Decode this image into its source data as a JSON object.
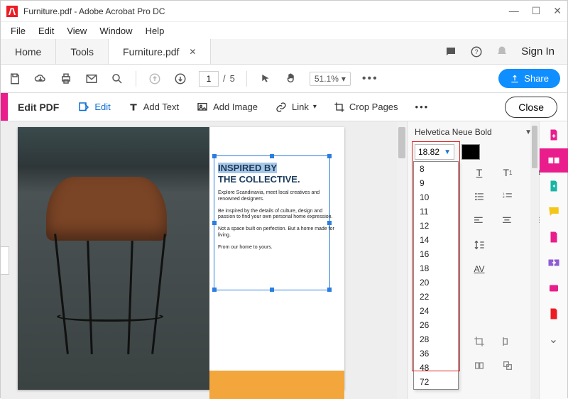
{
  "titlebar": {
    "title": "Furniture.pdf - Adobe Acrobat Pro DC"
  },
  "menu": {
    "file": "File",
    "edit": "Edit",
    "view": "View",
    "window": "Window",
    "help": "Help"
  },
  "tabs": {
    "home": "Home",
    "tools": "Tools",
    "doc": "Furniture.pdf",
    "signin": "Sign In"
  },
  "toolbar": {
    "page_current": "1",
    "page_sep": "/",
    "page_total": "5",
    "zoom": "51.1%",
    "share": "Share"
  },
  "editbar": {
    "title": "Edit PDF",
    "edit": "Edit",
    "add_text": "Add Text",
    "add_image": "Add Image",
    "link": "Link",
    "crop": "Crop Pages",
    "close": "Close"
  },
  "doc": {
    "headline1": "INSPIRED BY",
    "headline2": "THE COLLECTIVE.",
    "p1": "Explore Scandinavia, meet local creatives and renowned designers.",
    "p2": "Be inspired by the details of culture, design and passion to find your own personal home expression.",
    "p3": "Not a space built on perfection. But a home made for living.",
    "p4": "From our home to yours."
  },
  "props": {
    "font_name": "Helvetica Neue Bold",
    "font_size": "18.82",
    "size_options": [
      "8",
      "9",
      "10",
      "11",
      "12",
      "14",
      "16",
      "18",
      "20",
      "22",
      "24",
      "26",
      "28",
      "36",
      "48",
      "72"
    ]
  },
  "colors": {
    "accent_pink": "#e91e8c",
    "accent_blue": "#0f8eff"
  }
}
